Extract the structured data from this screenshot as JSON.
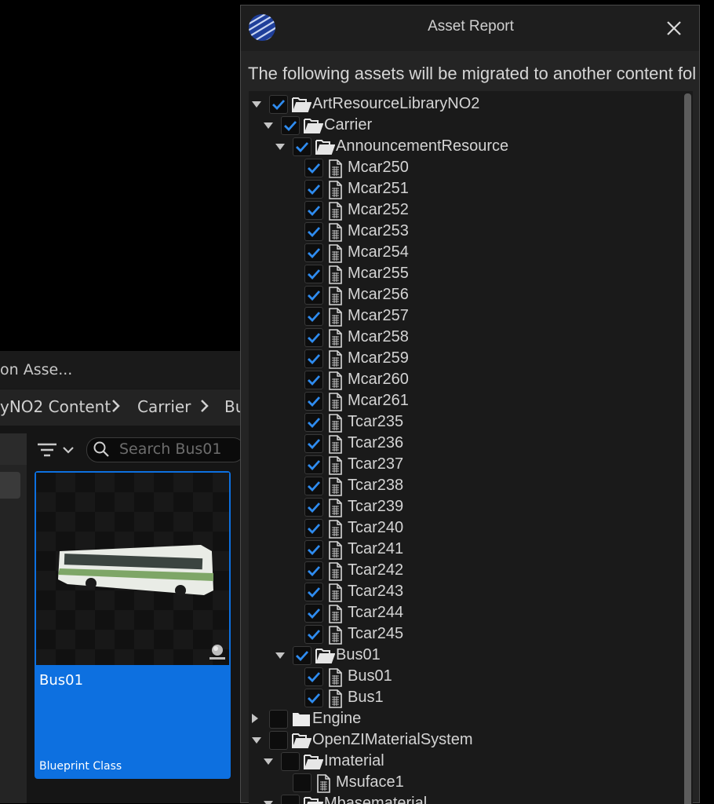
{
  "background": {
    "content_browser_title": "on Asse...",
    "breadcrumbs": [
      "yNO2 Content",
      "Carrier",
      "Bu"
    ],
    "search_placeholder": "Search Bus01",
    "asset": {
      "name": "Bus01",
      "type": "Blueprint Class"
    }
  },
  "dialog": {
    "title": "Asset Report",
    "message": "The following assets will be migrated to another content folder.",
    "tree": [
      {
        "label": "ArtResourceLibraryNO2",
        "depth": 0,
        "kind": "folder",
        "expanded": true,
        "checked": true
      },
      {
        "label": "Carrier",
        "depth": 1,
        "kind": "folder",
        "expanded": true,
        "checked": true
      },
      {
        "label": "AnnouncementResource",
        "depth": 2,
        "kind": "folder",
        "expanded": true,
        "checked": true
      },
      {
        "label": "Mcar250",
        "depth": 3,
        "kind": "file",
        "checked": true
      },
      {
        "label": "Mcar251",
        "depth": 3,
        "kind": "file",
        "checked": true
      },
      {
        "label": "Mcar252",
        "depth": 3,
        "kind": "file",
        "checked": true
      },
      {
        "label": "Mcar253",
        "depth": 3,
        "kind": "file",
        "checked": true
      },
      {
        "label": "Mcar254",
        "depth": 3,
        "kind": "file",
        "checked": true
      },
      {
        "label": "Mcar255",
        "depth": 3,
        "kind": "file",
        "checked": true
      },
      {
        "label": "Mcar256",
        "depth": 3,
        "kind": "file",
        "checked": true
      },
      {
        "label": "Mcar257",
        "depth": 3,
        "kind": "file",
        "checked": true
      },
      {
        "label": "Mcar258",
        "depth": 3,
        "kind": "file",
        "checked": true
      },
      {
        "label": "Mcar259",
        "depth": 3,
        "kind": "file",
        "checked": true
      },
      {
        "label": "Mcar260",
        "depth": 3,
        "kind": "file",
        "checked": true
      },
      {
        "label": "Mcar261",
        "depth": 3,
        "kind": "file",
        "checked": true
      },
      {
        "label": "Tcar235",
        "depth": 3,
        "kind": "file",
        "checked": true
      },
      {
        "label": "Tcar236",
        "depth": 3,
        "kind": "file",
        "checked": true
      },
      {
        "label": "Tcar237",
        "depth": 3,
        "kind": "file",
        "checked": true
      },
      {
        "label": "Tcar238",
        "depth": 3,
        "kind": "file",
        "checked": true
      },
      {
        "label": "Tcar239",
        "depth": 3,
        "kind": "file",
        "checked": true
      },
      {
        "label": "Tcar240",
        "depth": 3,
        "kind": "file",
        "checked": true
      },
      {
        "label": "Tcar241",
        "depth": 3,
        "kind": "file",
        "checked": true
      },
      {
        "label": "Tcar242",
        "depth": 3,
        "kind": "file",
        "checked": true
      },
      {
        "label": "Tcar243",
        "depth": 3,
        "kind": "file",
        "checked": true
      },
      {
        "label": "Tcar244",
        "depth": 3,
        "kind": "file",
        "checked": true
      },
      {
        "label": "Tcar245",
        "depth": 3,
        "kind": "file",
        "checked": true
      },
      {
        "label": "Bus01",
        "depth": 2,
        "kind": "folder",
        "expanded": true,
        "checked": true
      },
      {
        "label": "Bus01",
        "depth": 3,
        "kind": "file",
        "checked": true
      },
      {
        "label": "Bus1",
        "depth": 3,
        "kind": "file",
        "checked": true
      },
      {
        "label": "Engine",
        "depth": 0,
        "kind": "folder",
        "expanded": false,
        "checked": false
      },
      {
        "label": "OpenZIMaterialSystem",
        "depth": 0,
        "kind": "folder",
        "expanded": true,
        "checked": false
      },
      {
        "label": "Imaterial",
        "depth": 1,
        "kind": "folder",
        "expanded": true,
        "checked": false
      },
      {
        "label": "Msuface1",
        "depth": 2,
        "kind": "file",
        "checked": false
      },
      {
        "label": "Mbasematerial",
        "depth": 1,
        "kind": "folder",
        "expanded": true,
        "checked": false
      }
    ]
  },
  "colors": {
    "accent": "#0d70e0",
    "check": "#2f8cf0"
  },
  "icons": [
    "engine-logo-icon",
    "close-icon",
    "folder-open-icon",
    "folder-closed-icon",
    "file-icon",
    "checkmark-icon",
    "filter-icon",
    "search-icon",
    "chevron-right-icon"
  ]
}
